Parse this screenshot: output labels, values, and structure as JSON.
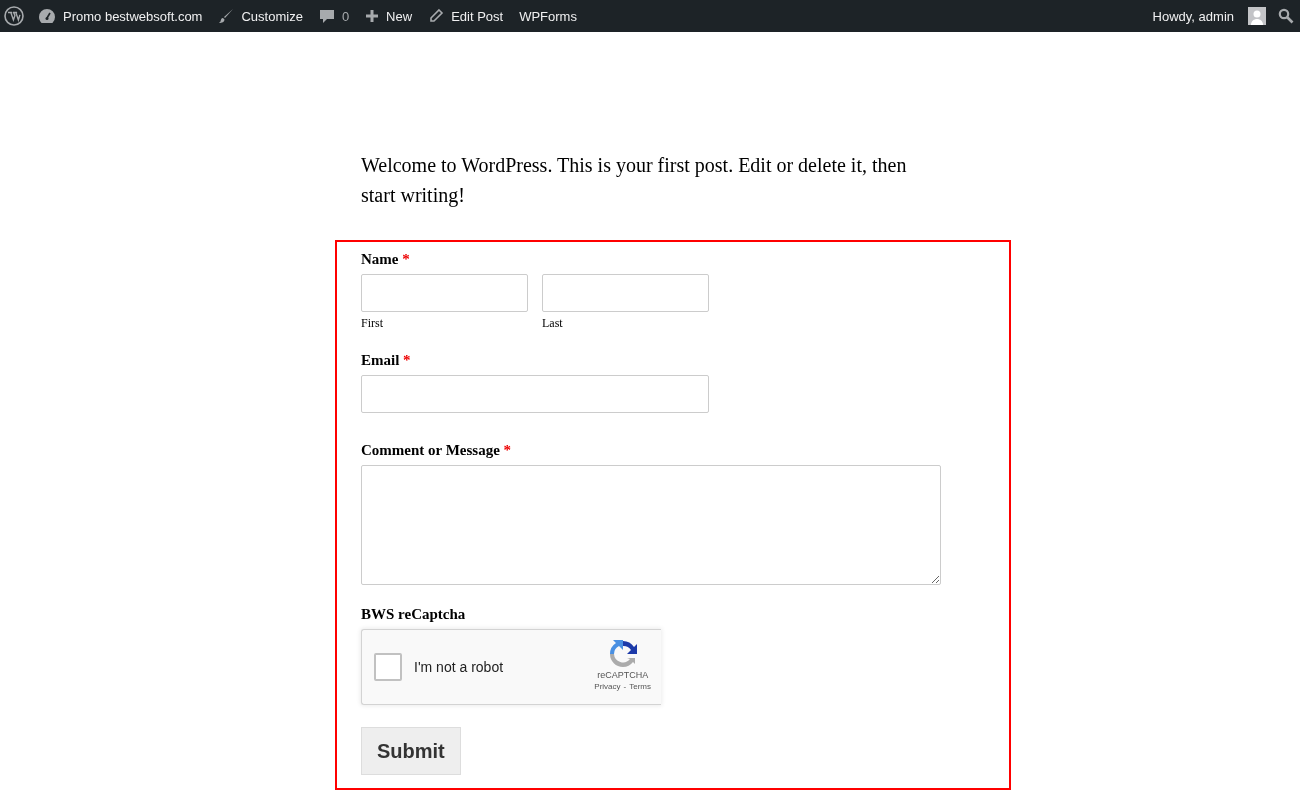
{
  "admin_bar": {
    "items": [
      {
        "kind": "logo"
      },
      {
        "kind": "site",
        "label": "Promo bestwebsoft.com"
      },
      {
        "kind": "brush",
        "label": "Customize"
      },
      {
        "kind": "comments",
        "label": "0"
      },
      {
        "kind": "plus",
        "label": "New"
      },
      {
        "kind": "pencil",
        "label": "Edit Post"
      },
      {
        "kind": "text",
        "label": "WPForms"
      }
    ],
    "greeting": "Howdy, admin"
  },
  "post": {
    "text": "Welcome to WordPress. This is your first post. Edit or delete it, then start writing!"
  },
  "form": {
    "fields": [
      {
        "kind": "name",
        "label": "Name",
        "required_mark": "*",
        "sublabels": [
          "First",
          "Last"
        ]
      },
      {
        "kind": "email",
        "label": "Email",
        "required_mark": "*"
      },
      {
        "kind": "textarea",
        "label": "Comment or Message",
        "required_mark": "*"
      },
      {
        "kind": "captcha",
        "label": "BWS reCaptcha",
        "checkbox_label": "I'm not a robot",
        "checked": false,
        "brand": "reCAPTCHA",
        "privacy": "Privacy",
        "separator": "-",
        "terms": "Terms"
      }
    ],
    "submit": "Submit"
  }
}
